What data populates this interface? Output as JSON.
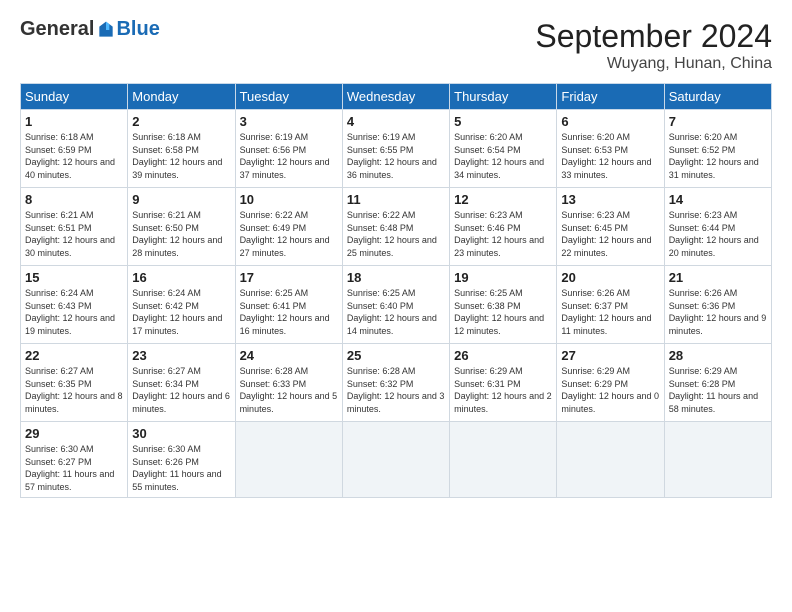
{
  "header": {
    "logo_general": "General",
    "logo_blue": "Blue",
    "month_title": "September 2024",
    "location": "Wuyang, Hunan, China"
  },
  "weekdays": [
    "Sunday",
    "Monday",
    "Tuesday",
    "Wednesday",
    "Thursday",
    "Friday",
    "Saturday"
  ],
  "weeks": [
    [
      {
        "day": "1",
        "sunrise": "6:18 AM",
        "sunset": "6:59 PM",
        "daylight": "12 hours and 40 minutes."
      },
      {
        "day": "2",
        "sunrise": "6:18 AM",
        "sunset": "6:58 PM",
        "daylight": "12 hours and 39 minutes."
      },
      {
        "day": "3",
        "sunrise": "6:19 AM",
        "sunset": "6:56 PM",
        "daylight": "12 hours and 37 minutes."
      },
      {
        "day": "4",
        "sunrise": "6:19 AM",
        "sunset": "6:55 PM",
        "daylight": "12 hours and 36 minutes."
      },
      {
        "day": "5",
        "sunrise": "6:20 AM",
        "sunset": "6:54 PM",
        "daylight": "12 hours and 34 minutes."
      },
      {
        "day": "6",
        "sunrise": "6:20 AM",
        "sunset": "6:53 PM",
        "daylight": "12 hours and 33 minutes."
      },
      {
        "day": "7",
        "sunrise": "6:20 AM",
        "sunset": "6:52 PM",
        "daylight": "12 hours and 31 minutes."
      }
    ],
    [
      {
        "day": "8",
        "sunrise": "6:21 AM",
        "sunset": "6:51 PM",
        "daylight": "12 hours and 30 minutes."
      },
      {
        "day": "9",
        "sunrise": "6:21 AM",
        "sunset": "6:50 PM",
        "daylight": "12 hours and 28 minutes."
      },
      {
        "day": "10",
        "sunrise": "6:22 AM",
        "sunset": "6:49 PM",
        "daylight": "12 hours and 27 minutes."
      },
      {
        "day": "11",
        "sunrise": "6:22 AM",
        "sunset": "6:48 PM",
        "daylight": "12 hours and 25 minutes."
      },
      {
        "day": "12",
        "sunrise": "6:23 AM",
        "sunset": "6:46 PM",
        "daylight": "12 hours and 23 minutes."
      },
      {
        "day": "13",
        "sunrise": "6:23 AM",
        "sunset": "6:45 PM",
        "daylight": "12 hours and 22 minutes."
      },
      {
        "day": "14",
        "sunrise": "6:23 AM",
        "sunset": "6:44 PM",
        "daylight": "12 hours and 20 minutes."
      }
    ],
    [
      {
        "day": "15",
        "sunrise": "6:24 AM",
        "sunset": "6:43 PM",
        "daylight": "12 hours and 19 minutes."
      },
      {
        "day": "16",
        "sunrise": "6:24 AM",
        "sunset": "6:42 PM",
        "daylight": "12 hours and 17 minutes."
      },
      {
        "day": "17",
        "sunrise": "6:25 AM",
        "sunset": "6:41 PM",
        "daylight": "12 hours and 16 minutes."
      },
      {
        "day": "18",
        "sunrise": "6:25 AM",
        "sunset": "6:40 PM",
        "daylight": "12 hours and 14 minutes."
      },
      {
        "day": "19",
        "sunrise": "6:25 AM",
        "sunset": "6:38 PM",
        "daylight": "12 hours and 12 minutes."
      },
      {
        "day": "20",
        "sunrise": "6:26 AM",
        "sunset": "6:37 PM",
        "daylight": "12 hours and 11 minutes."
      },
      {
        "day": "21",
        "sunrise": "6:26 AM",
        "sunset": "6:36 PM",
        "daylight": "12 hours and 9 minutes."
      }
    ],
    [
      {
        "day": "22",
        "sunrise": "6:27 AM",
        "sunset": "6:35 PM",
        "daylight": "12 hours and 8 minutes."
      },
      {
        "day": "23",
        "sunrise": "6:27 AM",
        "sunset": "6:34 PM",
        "daylight": "12 hours and 6 minutes."
      },
      {
        "day": "24",
        "sunrise": "6:28 AM",
        "sunset": "6:33 PM",
        "daylight": "12 hours and 5 minutes."
      },
      {
        "day": "25",
        "sunrise": "6:28 AM",
        "sunset": "6:32 PM",
        "daylight": "12 hours and 3 minutes."
      },
      {
        "day": "26",
        "sunrise": "6:29 AM",
        "sunset": "6:31 PM",
        "daylight": "12 hours and 2 minutes."
      },
      {
        "day": "27",
        "sunrise": "6:29 AM",
        "sunset": "6:29 PM",
        "daylight": "12 hours and 0 minutes."
      },
      {
        "day": "28",
        "sunrise": "6:29 AM",
        "sunset": "6:28 PM",
        "daylight": "11 hours and 58 minutes."
      }
    ],
    [
      {
        "day": "29",
        "sunrise": "6:30 AM",
        "sunset": "6:27 PM",
        "daylight": "11 hours and 57 minutes."
      },
      {
        "day": "30",
        "sunrise": "6:30 AM",
        "sunset": "6:26 PM",
        "daylight": "11 hours and 55 minutes."
      },
      null,
      null,
      null,
      null,
      null
    ]
  ]
}
